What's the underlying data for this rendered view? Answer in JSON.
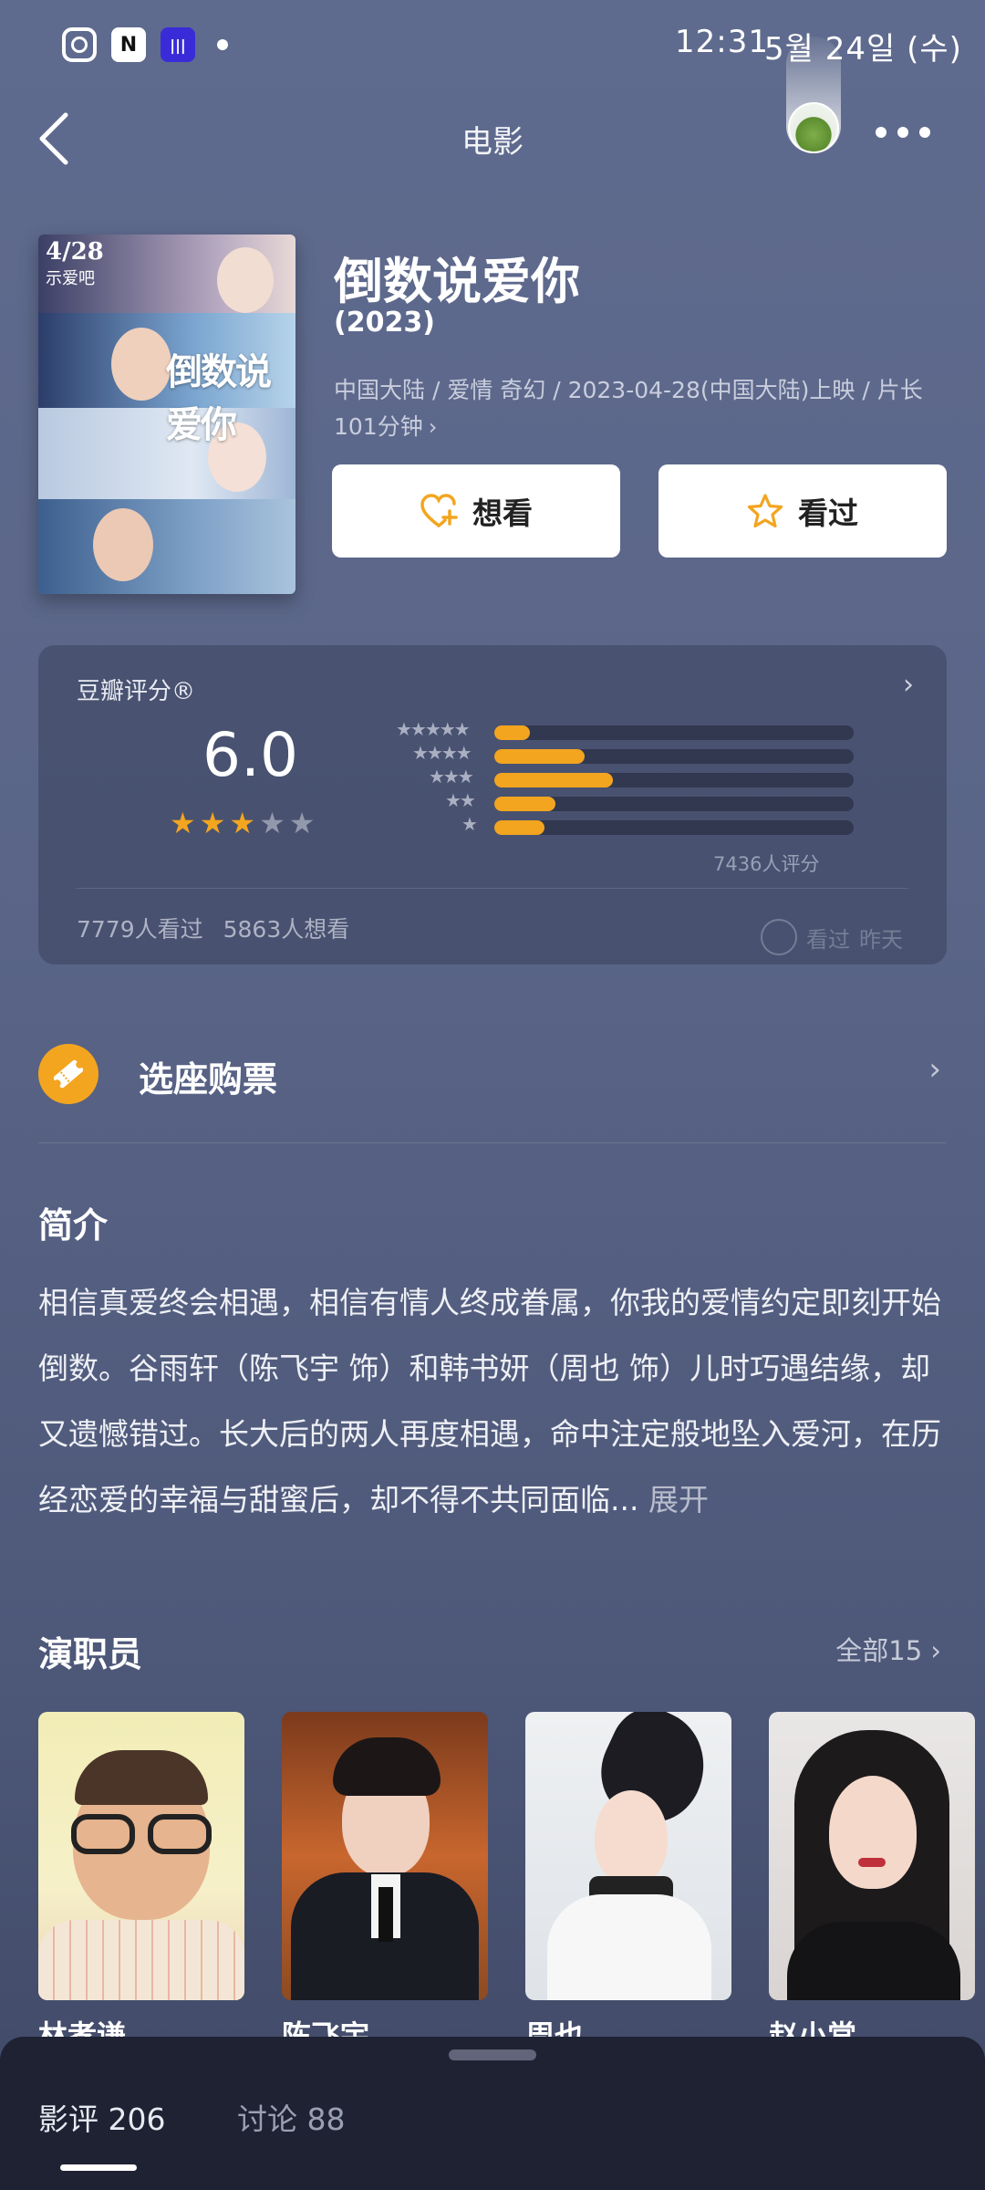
{
  "status_bar": {
    "time": "12:31",
    "date": "5월 24일 (수)",
    "icons": [
      "instagram-icon",
      "naver-icon",
      "barcode-app-icon",
      "notification-dot"
    ]
  },
  "nav": {
    "title": "电影",
    "back_icon": "chevron-left-icon",
    "more_icon": "more-dots-icon"
  },
  "poster": {
    "date_text": "4/28",
    "tagline": "示爱吧",
    "title_text": "倒数说爱你"
  },
  "movie": {
    "title": "倒数说爱你",
    "year": "(2023)",
    "meta": "中国大陆 / 爱情 奇幻 / 2023-04-28(中国大陆)上映 / 片长 101分钟",
    "meta_chevron": "›"
  },
  "actions": {
    "want_label": "想看",
    "seen_label": "看过",
    "want_icon": "heart-plus-icon",
    "seen_icon": "star-outline-icon"
  },
  "rating": {
    "label": "豆瓣评分®",
    "score": "6.0",
    "score_value": 6.0,
    "stars_filled": 3,
    "stars_total": 5,
    "distribution": [
      {
        "stars": "★★★★★",
        "percent": 10
      },
      {
        "stars": "★★★★",
        "percent": 25
      },
      {
        "stars": "★★★",
        "percent": 33
      },
      {
        "stars": "★★",
        "percent": 17
      },
      {
        "stars": "★",
        "percent": 14
      }
    ],
    "count_text": "7436人评分",
    "seen_count": "7779人看过",
    "want_count": "5863人想看",
    "watch_label": "看过",
    "watch_time": "昨天",
    "bar_color": "#f3a520"
  },
  "tickets": {
    "label": "选座购票",
    "icon": "ticket-icon"
  },
  "synopsis": {
    "heading": "简介",
    "text": "相信真爱终会相遇，相信有情人终成眷属，你我的爱情约定即刻开始倒数。谷雨轩（陈飞宇 饰）和韩书妍（周也 饰）儿时巧遇结缘，却又遗憾错过。长大后的两人再度相遇，命中注定般地坠入爱河，在历经恋爱的幸福与甜蜜后，却不得不共同面临...",
    "expand_label": "展开"
  },
  "cast": {
    "heading": "演职员",
    "all_label": "全部15",
    "members": [
      {
        "name": "林孝谦"
      },
      {
        "name": "陈飞宇"
      },
      {
        "name": "周也"
      },
      {
        "name": "赵小棠"
      }
    ]
  },
  "bottom_sheet": {
    "tabs": [
      {
        "label": "影评 206"
      },
      {
        "label": "讨论 88"
      }
    ]
  }
}
